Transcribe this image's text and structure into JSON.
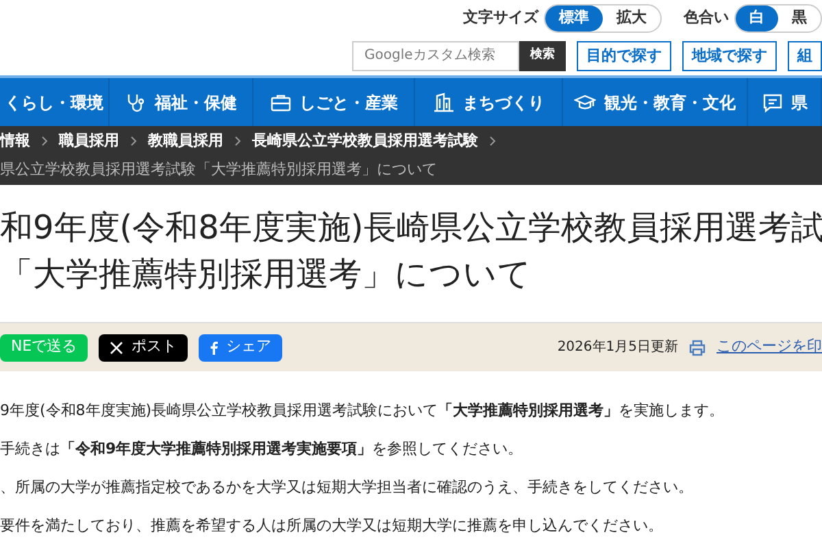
{
  "font_size": {
    "label": "文字サイズ",
    "options": [
      {
        "label": "標準",
        "selected": true
      },
      {
        "label": "拡大",
        "selected": false
      }
    ]
  },
  "color_scheme": {
    "label": "色合い",
    "options": [
      {
        "label": "白",
        "selected": true
      },
      {
        "label": "黒",
        "selected": false
      }
    ]
  },
  "search": {
    "placeholder": "Googleカスタム検索",
    "button": "検索"
  },
  "find_buttons": [
    "目的で探す",
    "地域で探す",
    "組"
  ],
  "nav": [
    {
      "label": "くらし・環境"
    },
    {
      "label": "福祉・保健"
    },
    {
      "label": "しごと・産業"
    },
    {
      "label": "まちづくり"
    },
    {
      "label": "観光・教育・文化"
    },
    {
      "label": "県"
    }
  ],
  "breadcrumb": [
    "情報",
    "職員採用",
    "教職員採用",
    "長崎県公立学校教員採用選考試験"
  ],
  "breadcrumb_current": "県公立学校教員採用選考試験「大学推薦特別採用選考」について",
  "title": [
    "和9年度(令和8年度実施)長崎県公立学校教員採用選考試",
    "「大学推薦特別採用選考」について"
  ],
  "share": [
    {
      "kind": "line",
      "label": "NEで送る"
    },
    {
      "kind": "x",
      "label": "ポスト"
    },
    {
      "kind": "facebook",
      "label": "シェア"
    }
  ],
  "updated": "2026年1月5日更新",
  "print_link": "このページを印",
  "paragraphs": [
    "9年度(令和8年度実施)長崎県公立学校教員採用選考試験において**「大学推薦特別採用選考」**を実施します。",
    "手続きは**「令和9年度大学推薦特別採用選考実施要項」**を参照してください。",
    "、所属の大学が推薦指定校であるかを大学又は短期大学担当者に確認のうえ、手続きをしてください。",
    "要件を満たしており、推薦を希望する人は所属の大学又は短期大学に推薦を申し込んでください。"
  ]
}
